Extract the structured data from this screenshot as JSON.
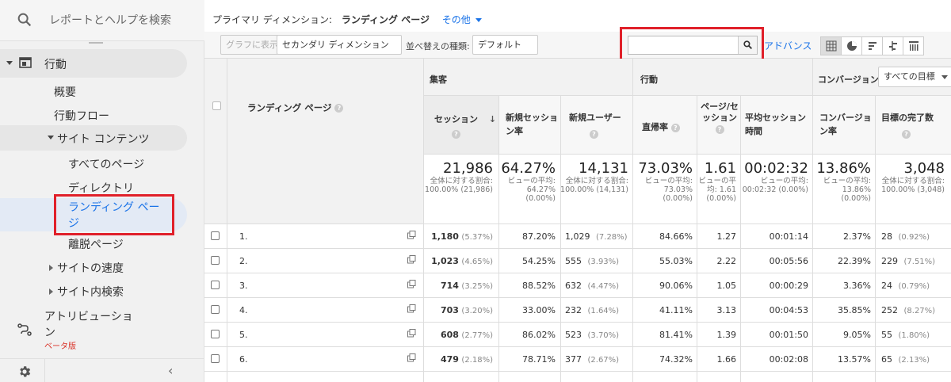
{
  "sidebar": {
    "search_label": "レポートとヘルプを検索",
    "section_behavior": "行動",
    "items": [
      "概要",
      "行動フロー"
    ],
    "site_content": "サイト コンテンツ",
    "site_content_items": [
      "すべてのページ",
      "ディレクトリ",
      "ランディング ページ",
      "離脱ページ"
    ],
    "site_speed": "サイトの速度",
    "site_search": "サイト内検索",
    "attribution": "アトリビューション",
    "beta": "ベータ版",
    "highlight_color": "#e0202a"
  },
  "dimension_bar": {
    "label": "プライマリ ディメンション:",
    "selected": "ランディング ページ",
    "other": "その他"
  },
  "toolbar": {
    "plot_rows": "グラフに表示",
    "secondary_dim": "セカンダリ ディメンション",
    "sort_label": "並べ替えの種類:",
    "sort_value": "デフォルト",
    "search_value": "",
    "advanced": "アドバンス"
  },
  "table": {
    "col_dim": "ランディング ページ",
    "groups": {
      "acquisition": "集客",
      "behavior": "行動",
      "conversions": "コンバージョン",
      "goal_select": "すべての目標"
    },
    "columns": [
      "セッション",
      "新規セッション率",
      "新規ユーザー",
      "直帰率",
      "ページ/セッション",
      "平均セッション時間",
      "コンバージョン率",
      "目標の完了数"
    ],
    "totals": {
      "sessions": "21,986",
      "sessions_sub": "全体に対する割合: 100.00% (21,986)",
      "new_rate": "64.27%",
      "new_rate_sub": "ビューの平均: 64.27% (0.00%)",
      "new_users": "14,131",
      "new_users_sub": "全体に対する割合: 100.00% (14,131)",
      "bounce": "73.03%",
      "bounce_sub": "ビューの平均: 73.03% (0.00%)",
      "pps": "1.61",
      "pps_sub": "ビューの平均: 1.61 (0.00%)",
      "duration": "00:02:32",
      "duration_sub": "ビューの平均: 00:02:32 (0.00%)",
      "conv": "13.86%",
      "conv_sub": "ビューの平均: 13.86% (0.00%)",
      "goals": "3,048",
      "goals_sub": "全体に対する割合: 100.00% (3,048)"
    },
    "rows": [
      {
        "idx": "1.",
        "sessions": "1,180",
        "s_pct": "(5.37%)",
        "new_rate": "87.20%",
        "new_users": "1,029",
        "nu_pct": "(7.28%)",
        "bounce": "84.66%",
        "pps": "1.27",
        "duration": "00:01:14",
        "conv": "2.37%",
        "goals": "28",
        "g_pct": "(0.92%)"
      },
      {
        "idx": "2.",
        "sessions": "1,023",
        "s_pct": "(4.65%)",
        "new_rate": "54.25%",
        "new_users": "555",
        "nu_pct": "(3.93%)",
        "bounce": "55.03%",
        "pps": "2.22",
        "duration": "00:05:56",
        "conv": "22.39%",
        "goals": "229",
        "g_pct": "(7.51%)"
      },
      {
        "idx": "3.",
        "sessions": "714",
        "s_pct": "(3.25%)",
        "new_rate": "88.52%",
        "new_users": "632",
        "nu_pct": "(4.47%)",
        "bounce": "90.06%",
        "pps": "1.05",
        "duration": "00:00:29",
        "conv": "3.36%",
        "goals": "24",
        "g_pct": "(0.79%)"
      },
      {
        "idx": "4.",
        "sessions": "703",
        "s_pct": "(3.20%)",
        "new_rate": "33.00%",
        "new_users": "232",
        "nu_pct": "(1.64%)",
        "bounce": "41.11%",
        "pps": "3.13",
        "duration": "00:04:53",
        "conv": "35.85%",
        "goals": "252",
        "g_pct": "(8.27%)"
      },
      {
        "idx": "5.",
        "sessions": "608",
        "s_pct": "(2.77%)",
        "new_rate": "86.02%",
        "new_users": "523",
        "nu_pct": "(3.70%)",
        "bounce": "81.41%",
        "pps": "1.39",
        "duration": "00:01:50",
        "conv": "9.05%",
        "goals": "55",
        "g_pct": "(1.80%)"
      },
      {
        "idx": "6.",
        "sessions": "479",
        "s_pct": "(2.18%)",
        "new_rate": "78.71%",
        "new_users": "377",
        "nu_pct": "(2.67%)",
        "bounce": "74.32%",
        "pps": "1.66",
        "duration": "00:02:08",
        "conv": "13.57%",
        "goals": "65",
        "g_pct": "(2.13%)"
      }
    ]
  }
}
